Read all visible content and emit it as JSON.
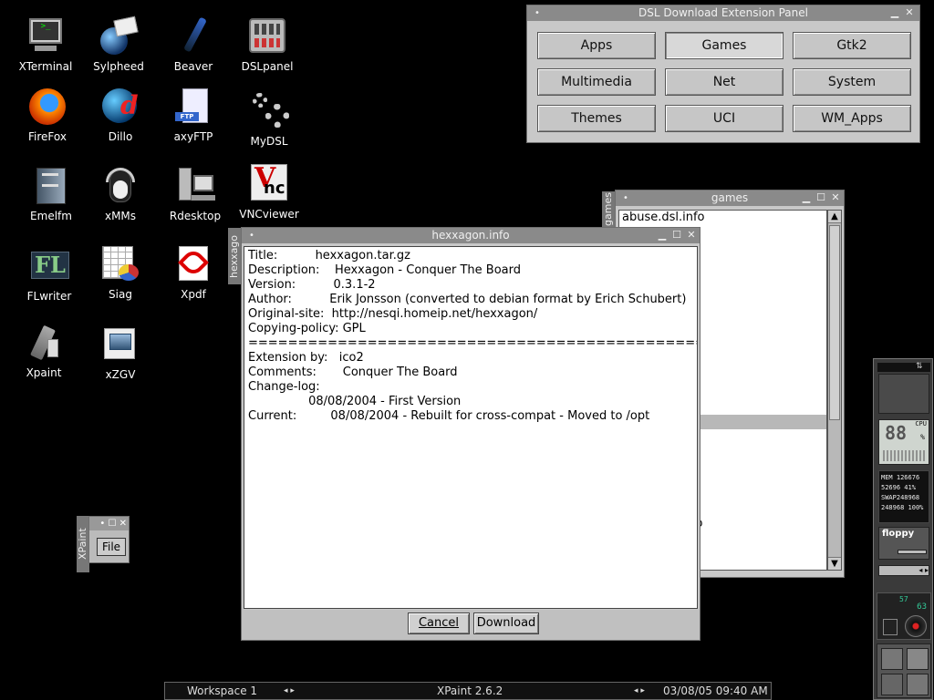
{
  "desktop": {
    "icons": [
      {
        "label": "XTerminal"
      },
      {
        "label": "Sylpheed"
      },
      {
        "label": "Beaver"
      },
      {
        "label": "DSLpanel"
      },
      {
        "label": "FireFox"
      },
      {
        "label": "Dillo"
      },
      {
        "label": "axyFTP"
      },
      {
        "label": "MyDSL"
      },
      {
        "label": "Emelfm"
      },
      {
        "label": "xMMs"
      },
      {
        "label": "Rdesktop"
      },
      {
        "label": "VNCviewer"
      },
      {
        "label": "FLwriter"
      },
      {
        "label": "Siag"
      },
      {
        "label": "Xpdf"
      },
      {
        "label": "Xpaint"
      },
      {
        "label": "xZGV"
      }
    ],
    "icon_text": {
      "ftp": "FTP",
      "fl": "FL",
      "vnc": "nc",
      "vnc_big": "V"
    }
  },
  "dsl_panel": {
    "title": "DSL Download Extension Panel",
    "buttons": [
      {
        "label": "Apps"
      },
      {
        "label": "Games"
      },
      {
        "label": "Gtk2"
      },
      {
        "label": "Multimedia"
      },
      {
        "label": "Net"
      },
      {
        "label": "System"
      },
      {
        "label": "Themes"
      },
      {
        "label": "UCI"
      },
      {
        "label": "WM_Apps"
      }
    ],
    "active": "Games"
  },
  "games_window": {
    "title": "games",
    "side_tab": "games",
    "rows": [
      "abuse.dsl.info",
      "",
      "",
      "fo",
      "",
      "o",
      ".info",
      "",
      "info",
      "o",
      "o",
      "nfo",
      "fo",
      "1-2.dsl.info",
      "",
      "",
      "",
      "o",
      "",
      "info",
      "nfo",
      "mand.dsl.info",
      "",
      "ms.dsl.info",
      "o"
    ],
    "selected_row": 14
  },
  "info_window": {
    "title": "hexxagon.info",
    "side_tab": "hexxago",
    "lines": [
      "Title:          hexxagon.tar.gz",
      "Description:    Hexxagon - Conquer The Board",
      "Version:          0.3.1-2",
      "Author:          Erik Jonsson (converted to debian format by Erich Schubert)",
      "Original-site:  http://nesqi.homeip.net/hexxagon/",
      "Copying-policy: GPL",
      "==================================================",
      "Extension by:   ico2",
      "Comments:       Conquer The Board",
      "Change-log:",
      "                08/08/2004 - First Version",
      "Current:         08/08/2004 - Rebuilt for cross-compat - Moved to /opt"
    ],
    "cancel_label": "Cancel",
    "download_label": "Download"
  },
  "xpaint_mini": {
    "side_tab": "XPaint",
    "file_label": "File",
    "controls": "• ☐ ✕"
  },
  "taskbar": {
    "workspace": "Workspace 1",
    "app": "XPaint 2.6.2",
    "clock": "03/08/05 09:40 AM",
    "arrows_left": "◂ ▸",
    "arrows_right": "◂ ▸"
  },
  "dock": {
    "cpu_value": "88",
    "cpu_label": "CPU",
    "cpu_unit": "%",
    "mem_label": "MEM",
    "mem_total": "126676",
    "mem_used": "52696",
    "mem_pct": "41%",
    "swap_label": "SWAP",
    "swap_total": "248968",
    "swap_free": "248968",
    "swap_pct": "100%",
    "floppy_label": "floppy",
    "volume_value": "63",
    "track_value": "57"
  },
  "colors": {
    "desktop": "#000000",
    "titlebar": "#8a8a8a",
    "window": "#c8c8c8"
  }
}
